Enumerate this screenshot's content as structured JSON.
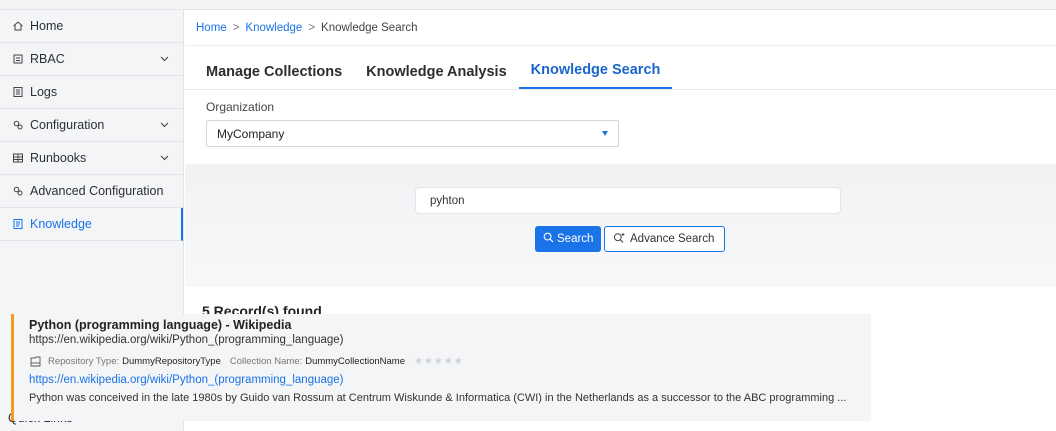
{
  "sidebar": {
    "items": [
      {
        "label": "Home",
        "icon": "home-icon",
        "expandable": false,
        "active": false
      },
      {
        "label": "RBAC",
        "icon": "rbac-icon",
        "expandable": true,
        "active": false
      },
      {
        "label": "Logs",
        "icon": "logs-icon",
        "expandable": false,
        "active": false
      },
      {
        "label": "Configuration",
        "icon": "config-icon",
        "expandable": true,
        "active": false
      },
      {
        "label": "Runbooks",
        "icon": "runbooks-icon",
        "expandable": true,
        "active": false
      },
      {
        "label": "Advanced Configuration",
        "icon": "config-icon",
        "expandable": false,
        "active": false
      },
      {
        "label": "Knowledge",
        "icon": "knowledge-icon",
        "expandable": false,
        "active": true
      }
    ],
    "quick_links": "Quick Links"
  },
  "breadcrumb": {
    "home": "Home",
    "knowledge": "Knowledge",
    "current": "Knowledge Search",
    "separator": ">"
  },
  "tabs": [
    {
      "label": "Manage Collections",
      "active": false
    },
    {
      "label": "Knowledge Analysis",
      "active": false
    },
    {
      "label": "Knowledge Search",
      "active": true
    }
  ],
  "organization": {
    "label": "Organization",
    "selected": "MyCompany"
  },
  "search": {
    "query": "pyhton",
    "search_label": "Search",
    "advance_label": "Advance Search"
  },
  "results": {
    "count_text": "5 Record(s) found",
    "items": [
      {
        "title": "Python (programming language) - Wikipedia",
        "url": "https://en.wikipedia.org/wiki/Python_(programming_language)",
        "repo_type_label": "Repository Type:",
        "repo_type": "DummyRepositoryType",
        "collection_label": "Collection Name:",
        "collection": "DummyCollectionName",
        "rating": 0,
        "link": "https://en.wikipedia.org/wiki/Python_(programming_language)",
        "description": "Python was conceived in the late 1980s by Guido van Rossum at Centrum Wiskunde & Informatica (CWI) in the Netherlands as a successor to the ABC programming ..."
      }
    ]
  },
  "colors": {
    "accent": "#1a73e8",
    "result_border": "#f29b20",
    "sidebar_bg": "#f4f5f7"
  }
}
